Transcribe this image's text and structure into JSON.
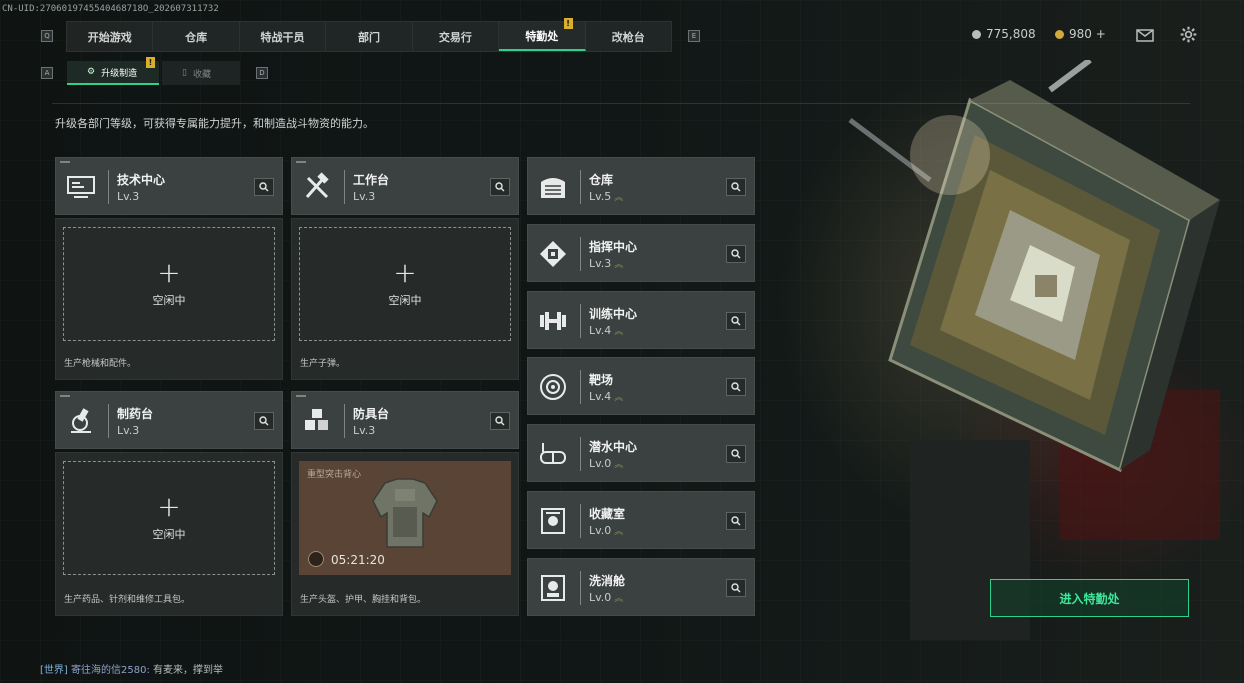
{
  "uid": "CN-UID:2706019745540468718O_202607311732",
  "nav": {
    "items": [
      {
        "label": "开始游戏",
        "active": false,
        "badge": ""
      },
      {
        "label": "仓库",
        "active": false,
        "badge": ""
      },
      {
        "label": "特战干员",
        "active": false,
        "badge": ""
      },
      {
        "label": "部门",
        "active": false,
        "badge": ""
      },
      {
        "label": "交易行",
        "active": false,
        "badge": ""
      },
      {
        "label": "特勤处",
        "active": true,
        "badge": "!"
      },
      {
        "label": "改枪台",
        "active": false,
        "badge": ""
      }
    ],
    "key_left": "Q",
    "key_right": "E"
  },
  "currency": {
    "silver": "775,808",
    "gold": "980 +"
  },
  "subtabs": {
    "key_left": "A",
    "key_right": "D",
    "upgrade_label": "升级制造",
    "upgrade_badge": "!",
    "collect_label": "收藏"
  },
  "description": "升级各部门等级，可获得专属能力提升，和制造战斗物资的能力。",
  "production": [
    {
      "name": "技术中心",
      "level": "Lv.3",
      "icon": "monitor-icon",
      "state": "idle",
      "idle_label": "空闲中",
      "note": "生产枪械和配件。"
    },
    {
      "name": "工作台",
      "level": "Lv.3",
      "icon": "tools-icon",
      "state": "idle",
      "idle_label": "空闲中",
      "note": "生产子弹。"
    },
    {
      "name": "制药台",
      "level": "Lv.3",
      "icon": "microscope-icon",
      "state": "idle",
      "idle_label": "空闲中",
      "note": "生产药品、针剂和维修工具包。"
    },
    {
      "name": "防具台",
      "level": "Lv.3",
      "icon": "blocks-icon",
      "state": "crafting",
      "item_name": "重型突击背心",
      "timer": "05:21:20",
      "note": "生产头盔、护甲、胸挂和背包。"
    }
  ],
  "facilities": [
    {
      "name": "仓库",
      "level": "Lv.5",
      "icon": "warehouse-icon"
    },
    {
      "name": "指挥中心",
      "level": "Lv.3",
      "icon": "command-icon"
    },
    {
      "name": "训练中心",
      "level": "Lv.4",
      "icon": "dumbbell-icon"
    },
    {
      "name": "靶场",
      "level": "Lv.4",
      "icon": "target-icon"
    },
    {
      "name": "潜水中心",
      "level": "Lv.0",
      "icon": "diving-mask-icon"
    },
    {
      "name": "收藏室",
      "level": "Lv.0",
      "icon": "vault-icon"
    },
    {
      "name": "洗消舱",
      "level": "Lv.0",
      "icon": "hazmat-icon"
    }
  ],
  "enter_button": "进入特勤处",
  "chat": {
    "channel": "[世界]",
    "sender": "寄往海的信2580:",
    "message": "有麦来，撑到举"
  },
  "colors": {
    "accent": "#2fd08a",
    "badge": "#d8b02c",
    "card": "#3b4140"
  }
}
